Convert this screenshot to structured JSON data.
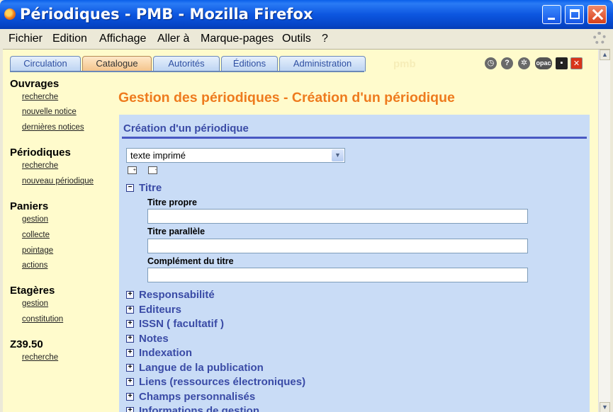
{
  "window": {
    "title": "Périodiques - PMB - Mozilla Firefox"
  },
  "menubar": [
    {
      "label": "Fichier"
    },
    {
      "label": "Edition"
    },
    {
      "label": "Affichage"
    },
    {
      "label": "Aller à"
    },
    {
      "label": "Marque-pages"
    },
    {
      "label": "Outils"
    },
    {
      "label": "?"
    }
  ],
  "tabs": [
    {
      "label": "Circulation"
    },
    {
      "label": "Catalogue"
    },
    {
      "label": "Autorités"
    },
    {
      "label": "Éditions"
    },
    {
      "label": "Administration"
    }
  ],
  "brand": "pmb",
  "toolbar_icons": {
    "opac": "opac"
  },
  "leftmenu": {
    "ouvrages": {
      "title": "Ouvrages",
      "links": [
        "recherche",
        "nouvelle notice",
        "dernières notices"
      ]
    },
    "periodiques": {
      "title": "Périodiques",
      "links": [
        "recherche",
        "nouveau périodique"
      ]
    },
    "paniers": {
      "title": "Paniers",
      "links": [
        "gestion",
        "collecte",
        "pointage",
        "actions"
      ]
    },
    "etageres": {
      "title": "Etagères",
      "links": [
        "gestion",
        "constitution"
      ]
    },
    "z3950": {
      "title": "Z39.50",
      "links": [
        "recherche"
      ]
    }
  },
  "page": {
    "title": "Gestion des périodiques - Création d'un périodique",
    "panel_title": "Création d'un périodique",
    "doc_type_selected": "texte imprimé",
    "titre_section": "Titre",
    "fields": {
      "titre_propre": {
        "label": "Titre propre",
        "value": ""
      },
      "titre_parallele": {
        "label": "Titre parallèle",
        "value": ""
      },
      "complement": {
        "label": "Complément du titre",
        "value": ""
      }
    },
    "sections": [
      "Responsabilité",
      "Editeurs",
      "ISSN ( facultatif )",
      "Notes",
      "Indexation",
      "Langue de la publication",
      "Liens (ressources électroniques)",
      "Champs personnalisés",
      "Informations de gestion"
    ],
    "toggle_expanded": "−",
    "toggle_collapsed": "+"
  }
}
